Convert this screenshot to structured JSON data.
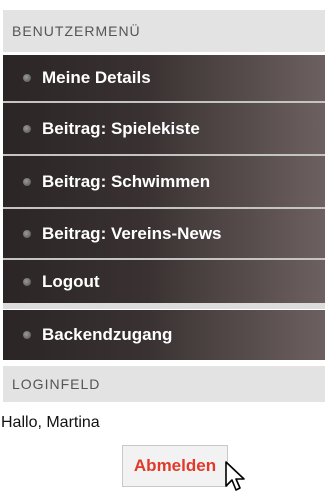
{
  "user_menu": {
    "header": "BENUTZERMENÜ",
    "items": [
      {
        "label": "Meine Details"
      },
      {
        "label": "Beitrag: Spielekiste"
      },
      {
        "label": "Beitrag: Schwimmen"
      },
      {
        "label": "Beitrag: Vereins-News"
      },
      {
        "label": "Logout"
      },
      {
        "label": "Backendzugang"
      }
    ]
  },
  "login": {
    "header": "LOGINFELD",
    "greeting": "Hallo, Martina",
    "logout_button": "Abmelden"
  },
  "colors": {
    "menu_bg_dark": "#2b2525",
    "menu_bg_light": "#6d6060",
    "header_bg": "#e3e3e3",
    "button_text": "#e23a2a"
  },
  "icons": [
    "bullet-icon",
    "mouse-pointer-icon"
  ]
}
